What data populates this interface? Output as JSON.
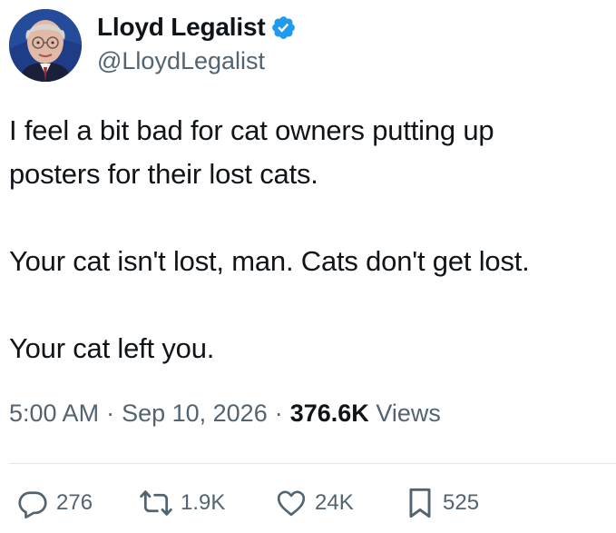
{
  "author": {
    "display_name": "Lloyd Legalist",
    "handle": "@LloydLegalist",
    "verified": true,
    "avatar": "portrait-avatar"
  },
  "tweet": {
    "paragraphs": [
      "I feel a bit bad for cat owners putting up\nposters for their lost cats.",
      "Your cat isn't lost, man. Cats don't get lost.",
      "Your cat left you."
    ],
    "time": "5:00 AM",
    "separator": "·",
    "date": "Sep 10, 2026",
    "views_count": "376.6K",
    "views_label": "Views"
  },
  "actions": {
    "reply": {
      "icon": "reply-icon",
      "count": "276"
    },
    "retweet": {
      "icon": "retweet-icon",
      "count": "1.9K"
    },
    "like": {
      "icon": "heart-icon",
      "count": "24K"
    },
    "bookmark": {
      "icon": "bookmark-icon",
      "count": "525"
    }
  },
  "colors": {
    "text_primary": "#0f1419",
    "text_secondary": "#536471",
    "verified_blue": "#1d9bf0",
    "divider": "#e1e6ea"
  }
}
